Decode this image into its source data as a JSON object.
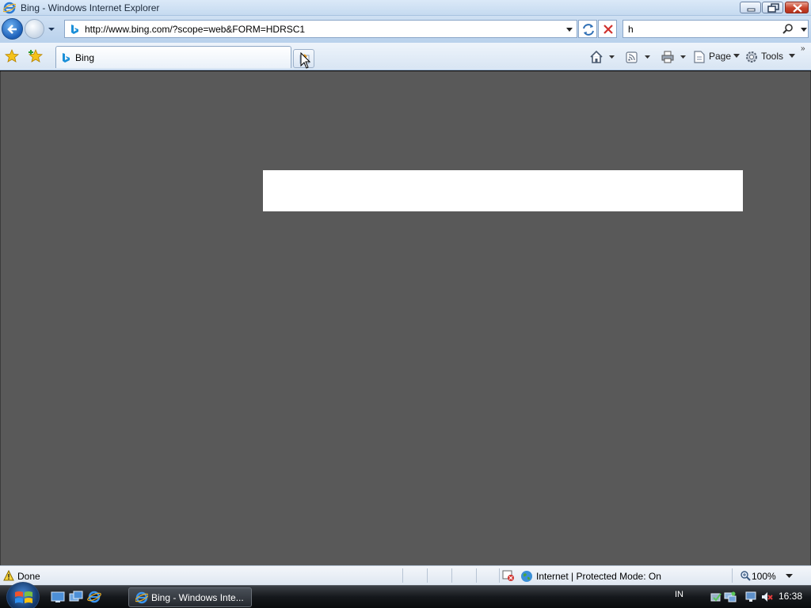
{
  "window": {
    "title": "Bing - Windows Internet Explorer"
  },
  "navigation": {
    "address_url": "http://www.bing.com/?scope=web&FORM=HDRSC1",
    "search_value": "h"
  },
  "tabs": [
    {
      "label": "Bing"
    }
  ],
  "commands": {
    "page_label": "Page",
    "tools_label": "Tools",
    "more_label": "»"
  },
  "statusbar": {
    "status_text": "Done",
    "zone_text": "Internet | Protected Mode: On",
    "zoom_text": "100%"
  },
  "taskbar": {
    "task_label": "Bing - Windows Inte...",
    "language": "IN",
    "clock": "16:38"
  },
  "colors": {
    "content_background": "#595959",
    "overlay_box": "#ffffff"
  }
}
